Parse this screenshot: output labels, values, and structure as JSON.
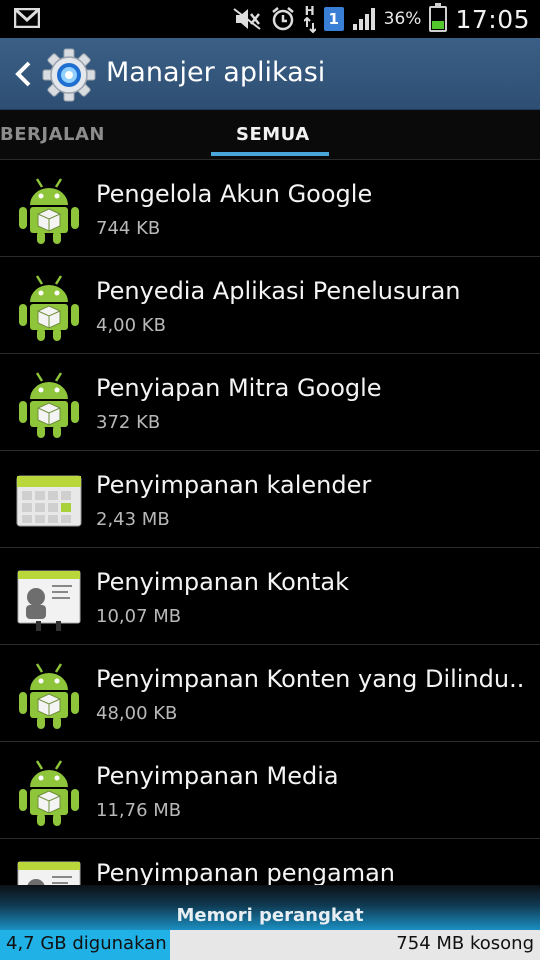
{
  "status_bar": {
    "battery_percent": "36%",
    "battery_level": 0.36,
    "sim_slot": "1",
    "network_type": "H",
    "time": "17:05",
    "icons": [
      "gmail-icon",
      "mute-icon",
      "alarm-icon",
      "data-arrows-icon",
      "signal-icon",
      "battery-icon"
    ]
  },
  "action_bar": {
    "title": "Manajer aplikasi"
  },
  "tabs": [
    {
      "label": "BERJALAN",
      "selected": false
    },
    {
      "label": "SEMUA",
      "selected": true
    }
  ],
  "apps": [
    {
      "name": "Pengelola Akun Google",
      "size": "744 KB",
      "icon": "android-robot-icon"
    },
    {
      "name": "Penyedia Aplikasi Penelusuran",
      "size": "4,00 KB",
      "icon": "android-robot-icon"
    },
    {
      "name": "Penyiapan Mitra Google",
      "size": "372 KB",
      "icon": "android-robot-icon"
    },
    {
      "name": "Penyimpanan kalender",
      "size": "2,43 MB",
      "icon": "calendar-storage-icon"
    },
    {
      "name": "Penyimpanan Kontak",
      "size": "10,07 MB",
      "icon": "contacts-storage-icon"
    },
    {
      "name": "Penyimpanan Konten yang Dilindu..",
      "size": "48,00 KB",
      "icon": "android-robot-icon"
    },
    {
      "name": "Penyimpanan Media",
      "size": "11,76 MB",
      "icon": "android-robot-icon"
    },
    {
      "name": "Penyimpanan pengaman",
      "size": "",
      "icon": "contacts-storage-icon"
    }
  ],
  "storage": {
    "label": "Memori perangkat",
    "used": "4,7 GB digunakan",
    "free": "754 MB kosong",
    "colors": {
      "used": "#20b1e6",
      "free": "#e7e7e7"
    }
  },
  "colors": {
    "action_bar": "#3b5f86",
    "tab_indicator": "#4aa6d8",
    "android_green": "#8fc53a"
  }
}
